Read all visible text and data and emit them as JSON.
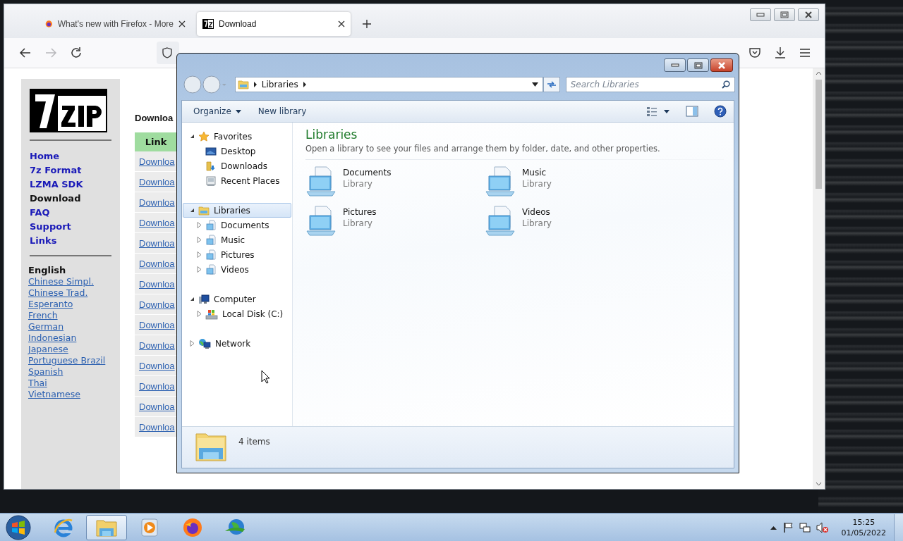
{
  "browser": {
    "tabs": [
      {
        "title": "What's new with Firefox - More",
        "kind": "firefox",
        "selected": false
      },
      {
        "title": "Download",
        "kind": "sevenzip",
        "selected": true
      }
    ],
    "forward_disabled": true
  },
  "page": {
    "nav": [
      {
        "label": "Home",
        "current": false
      },
      {
        "label": "7z Format",
        "current": false
      },
      {
        "label": "LZMA SDK",
        "current": false
      },
      {
        "label": "Download",
        "current": true
      },
      {
        "label": "FAQ",
        "current": false
      },
      {
        "label": "Support",
        "current": false
      },
      {
        "label": "Links",
        "current": false
      }
    ],
    "language_heading": "English",
    "languages": [
      "Chinese Simpl.",
      "Chinese Trad.",
      "Esperanto",
      "French",
      "German",
      "Indonesian",
      "Japanese",
      "Portuguese Brazil",
      "Spanish",
      "Thai",
      "Vietnamese"
    ],
    "heading": "Downloa",
    "table": {
      "header": "Link",
      "rows": [
        "Downloa",
        "Downloa",
        "Downloa",
        "Downloa",
        "Downloa",
        "Downloa",
        "Downloa",
        "Downloa",
        "Downloa",
        "Downloa",
        "Downloa",
        "Downloa",
        "Downloa",
        "Downloa"
      ]
    }
  },
  "explorer": {
    "breadcrumb": "Libraries",
    "search_placeholder": "Search Libraries",
    "toolbar": [
      {
        "label": "Organize",
        "dropdown": true
      },
      {
        "label": "New library",
        "dropdown": false
      }
    ],
    "tree": [
      {
        "label": "Favorites",
        "kind": "favorites",
        "expanded": true,
        "selected": false,
        "children": [
          {
            "label": "Desktop",
            "kind": "desktop",
            "selected": false
          },
          {
            "label": "Downloads",
            "kind": "downloads",
            "selected": false
          },
          {
            "label": "Recent Places",
            "kind": "recent",
            "selected": false
          }
        ]
      },
      {
        "label": "Libraries",
        "kind": "libraries",
        "expanded": true,
        "selected": true,
        "children": [
          {
            "label": "Documents",
            "kind": "library",
            "expanded": false,
            "selected": false
          },
          {
            "label": "Music",
            "kind": "library",
            "expanded": false,
            "selected": false
          },
          {
            "label": "Pictures",
            "kind": "library",
            "expanded": false,
            "selected": false
          },
          {
            "label": "Videos",
            "kind": "library",
            "expanded": false,
            "selected": false
          }
        ]
      },
      {
        "label": "Computer",
        "kind": "computer",
        "expanded": true,
        "selected": false,
        "children": [
          {
            "label": "Local Disk (C:)",
            "kind": "disk",
            "expanded": false,
            "selected": false
          }
        ]
      },
      {
        "label": "Network",
        "kind": "network",
        "expanded": false,
        "selected": false
      }
    ],
    "title": "Libraries",
    "subtitle": "Open a library to see your files and arrange them by folder, date, and other properties.",
    "items": [
      {
        "name": "Documents",
        "type": "Library"
      },
      {
        "name": "Music",
        "type": "Library"
      },
      {
        "name": "Pictures",
        "type": "Library"
      },
      {
        "name": "Videos",
        "type": "Library"
      }
    ],
    "status": "4 items"
  },
  "taskbar": {
    "apps": [
      {
        "kind": "ie",
        "selected": false
      },
      {
        "kind": "explorer",
        "selected": true
      },
      {
        "kind": "media",
        "selected": false
      },
      {
        "kind": "firefox",
        "selected": false
      },
      {
        "kind": "globe",
        "selected": false
      }
    ],
    "time": "15:25",
    "date": "01/05/2022"
  }
}
